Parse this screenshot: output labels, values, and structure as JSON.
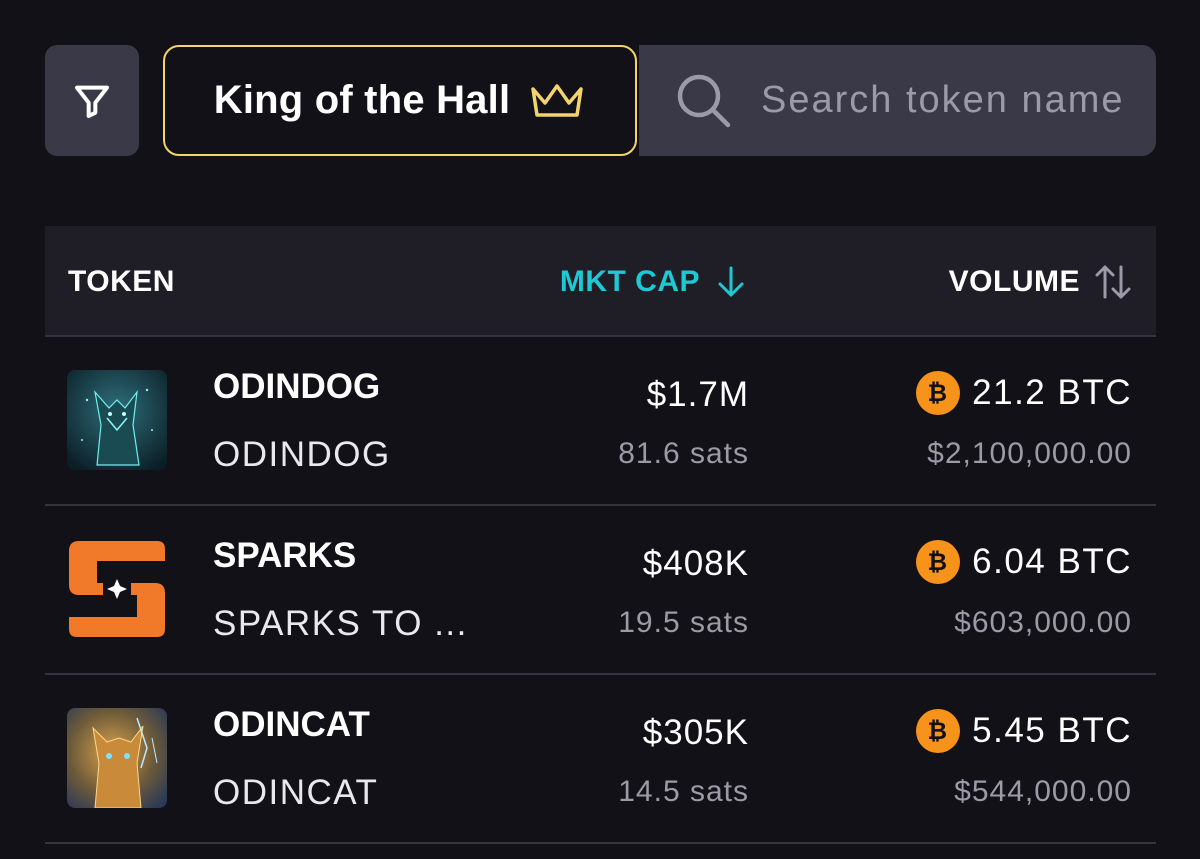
{
  "toolbar": {
    "filter_icon": "filter-icon",
    "king_label": "King of the Hall",
    "king_icon": "crown-icon",
    "search_placeholder": "Search token name"
  },
  "table": {
    "columns": {
      "token": "TOKEN",
      "mkt_cap": "MKT CAP",
      "volume": "VOLUME"
    },
    "sort": {
      "mkt_cap": "descending",
      "volume": "unsorted"
    },
    "rows": [
      {
        "name": "ODINDOG",
        "subtitle": "ODINDOG",
        "mkt_cap": "$1.7M",
        "price": "81.6 sats",
        "volume_btc": "21.2 BTC",
        "volume_usd": "$2,100,000.00"
      },
      {
        "name": "SPARKS",
        "subtitle": "SPARKS TO ...",
        "mkt_cap": "$408K",
        "price": "19.5 sats",
        "volume_btc": "6.04 BTC",
        "volume_usd": "$603,000.00"
      },
      {
        "name": "ODINCAT",
        "subtitle": "ODINCAT",
        "mkt_cap": "$305K",
        "price": "14.5 sats",
        "volume_btc": "5.45 BTC",
        "volume_usd": "$544,000.00"
      }
    ]
  },
  "colors": {
    "accent_cyan": "#1ec9d4",
    "gold": "#f3d46b",
    "btc_orange": "#f7931a",
    "background": "#121117"
  }
}
